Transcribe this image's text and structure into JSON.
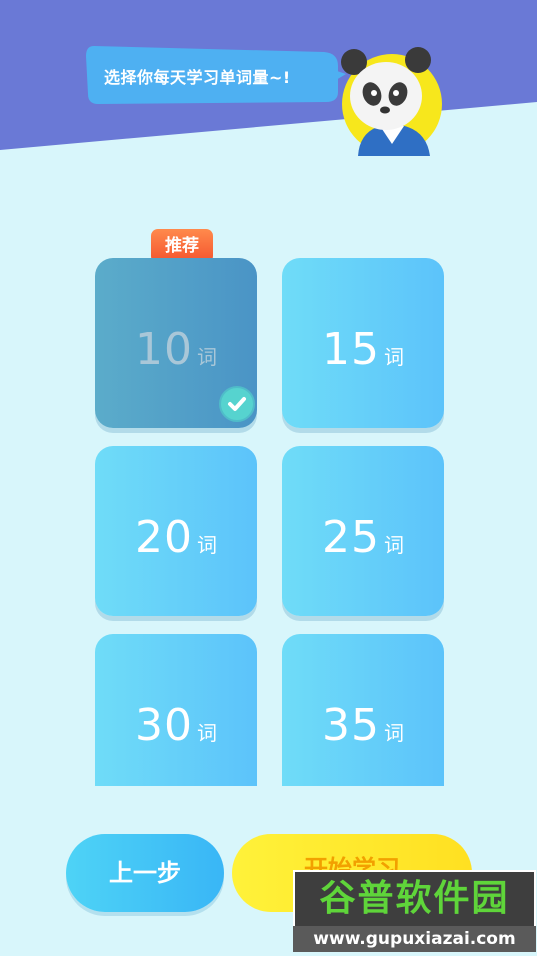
{
  "header": {
    "prompt": "选择你每天学习单词量~!"
  },
  "recommend_badge": "推荐",
  "options": [
    {
      "number": "10",
      "unit": "词",
      "selected": true
    },
    {
      "number": "15",
      "unit": "词",
      "selected": false
    },
    {
      "number": "20",
      "unit": "词",
      "selected": false
    },
    {
      "number": "25",
      "unit": "词",
      "selected": false
    },
    {
      "number": "30",
      "unit": "词",
      "selected": false
    },
    {
      "number": "35",
      "unit": "词",
      "selected": false
    }
  ],
  "buttons": {
    "prev": "上一步",
    "start": "开始学习"
  },
  "watermark": {
    "name": "谷普软件园",
    "url": "www.gupuxiazai.com"
  },
  "colors": {
    "header_bg": "#6a79d6",
    "page_bg": "#d8f6fb",
    "card": "#5cc3fa",
    "selected_card": "#4a94c6",
    "badge": "#f4532e",
    "start_button": "#fff23a"
  }
}
